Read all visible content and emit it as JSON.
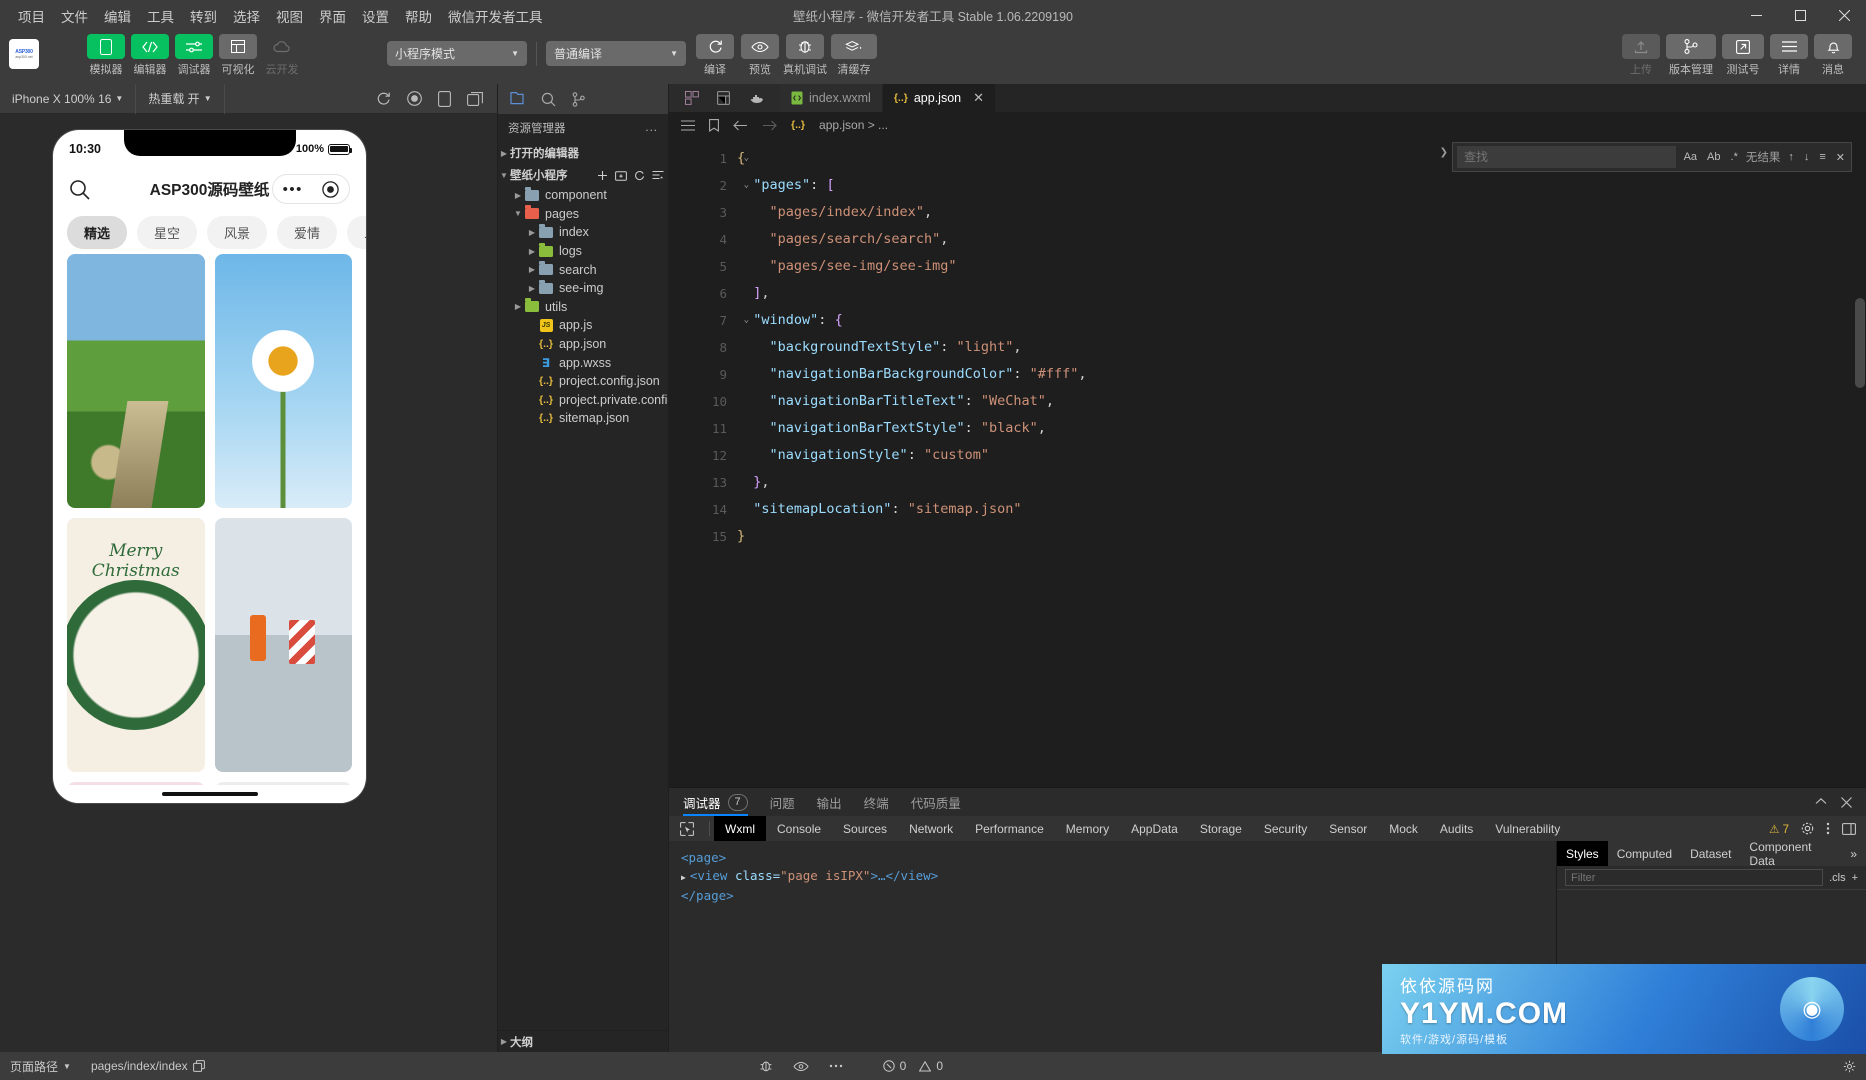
{
  "window": {
    "title": "壁纸小程序 - 微信开发者工具 Stable 1.06.2209190",
    "controls": {
      "minimize": "—",
      "maximize": "▢",
      "close": "✕"
    }
  },
  "menubar": [
    "项目",
    "文件",
    "编辑",
    "工具",
    "转到",
    "选择",
    "视图",
    "界面",
    "设置",
    "帮助",
    "微信开发者工具"
  ],
  "toolbar": {
    "logo": {
      "line1": "ASP300",
      "line2": "asp300.net"
    },
    "left_buttons": [
      {
        "label": "模拟器",
        "icon": "phone-icon",
        "style": "green"
      },
      {
        "label": "编辑器",
        "icon": "code-icon",
        "style": "green"
      },
      {
        "label": "调试器",
        "icon": "sliders-icon",
        "style": "green"
      },
      {
        "label": "可视化",
        "icon": "layout-icon",
        "style": "grey"
      },
      {
        "label": "云开发",
        "icon": "cloud-icon",
        "style": "dim"
      }
    ],
    "mode_select": "小程序模式",
    "compile_select": "普通编译",
    "action_buttons": [
      {
        "label": "编译",
        "icon": "refresh-icon"
      },
      {
        "label": "预览",
        "icon": "eye-icon"
      },
      {
        "label": "真机调试",
        "icon": "bug-icon"
      },
      {
        "label": "清缓存",
        "icon": "layers-icon"
      }
    ],
    "right_buttons": [
      {
        "label": "上传",
        "icon": "upload-icon",
        "disabled": true
      },
      {
        "label": "版本管理",
        "icon": "branch-icon",
        "disabled": false
      },
      {
        "label": "测试号",
        "icon": "external-link-icon",
        "disabled": false
      },
      {
        "label": "详情",
        "icon": "menu-icon",
        "disabled": false
      },
      {
        "label": "消息",
        "icon": "bell-icon",
        "disabled": false
      }
    ]
  },
  "simulator": {
    "device_select": "iPhone X 100% 16",
    "hotreload_select": "热重载 开",
    "icons": [
      "refresh-icon",
      "record-icon",
      "rotate-icon",
      "panel-icon"
    ],
    "phone": {
      "time": "10:30",
      "battery_text": "100%",
      "nav_title": "ASP300源码壁纸",
      "search_icon": "search-icon",
      "capsule": {
        "dots": "•••",
        "target": "◉"
      },
      "tabs": [
        "精选",
        "星空",
        "风景",
        "爱情",
        "二次"
      ],
      "active_tab": "精选",
      "cards": [
        {
          "name": "road-landscape",
          "art": "art-road"
        },
        {
          "name": "daisy-flower",
          "art": "art-daisy"
        },
        {
          "name": "merry-christmas-rabbit",
          "art": "art-xmas"
        },
        {
          "name": "miniature-workers",
          "art": "art-mini"
        },
        {
          "name": "pink-abstract",
          "art": "art-pk"
        },
        {
          "name": "white-abstract",
          "art": "art-wt"
        }
      ]
    }
  },
  "explorer": {
    "header": "资源管理器",
    "header_dots": "...",
    "top_icons": [
      "files-icon",
      "search-icon",
      "source-control-icon"
    ],
    "sections": [
      {
        "label": "打开的编辑器",
        "expanded": false
      },
      {
        "label": "壁纸小程序",
        "expanded": true
      }
    ],
    "section_actions": [
      "new-file-icon",
      "new-folder-icon",
      "refresh-icon",
      "collapse-icon"
    ],
    "tree": [
      {
        "label": "component",
        "type": "folder",
        "depth": 1,
        "open": false
      },
      {
        "label": "pages",
        "type": "folder-red",
        "depth": 1,
        "open": true
      },
      {
        "label": "index",
        "type": "folder",
        "depth": 2,
        "open": false
      },
      {
        "label": "logs",
        "type": "folder-green",
        "depth": 2,
        "open": false
      },
      {
        "label": "search",
        "type": "folder",
        "depth": 2,
        "open": false
      },
      {
        "label": "see-img",
        "type": "folder",
        "depth": 2,
        "open": false
      },
      {
        "label": "utils",
        "type": "folder-green",
        "depth": 1,
        "open": false
      },
      {
        "label": "app.js",
        "type": "js",
        "depth": 2
      },
      {
        "label": "app.json",
        "type": "json",
        "depth": 2
      },
      {
        "label": "app.wxss",
        "type": "wxss",
        "depth": 2
      },
      {
        "label": "project.config.json",
        "type": "json",
        "depth": 2
      },
      {
        "label": "project.private.config.js...",
        "type": "json",
        "depth": 2
      },
      {
        "label": "sitemap.json",
        "type": "json",
        "depth": 2
      }
    ],
    "outline": "大纲"
  },
  "editor": {
    "mini_icons": [
      "components-icon",
      "snippet-icon",
      "docker-icon"
    ],
    "tabs": [
      {
        "label": "index.wxml",
        "icon": "wxml-icon",
        "active": false,
        "closable": false
      },
      {
        "label": "app.json",
        "icon": "json-icon",
        "active": true,
        "closable": true
      }
    ],
    "breadcrumb_icons": [
      "list-icon",
      "bookmark-icon",
      "back-icon",
      "forward-icon"
    ],
    "breadcrumb": "app.json > ...",
    "find": {
      "placeholder": "查找",
      "value": "",
      "result": "无结果",
      "options": [
        "Aa",
        "Ab",
        ".*"
      ],
      "nav": [
        "↑",
        "↓",
        "≡",
        "✕"
      ]
    },
    "lines": [
      {
        "n": 1,
        "fold": "open",
        "tokens": [
          {
            "t": "{",
            "c": "k-y"
          }
        ]
      },
      {
        "n": 2,
        "fold": "open",
        "tokens": [
          {
            "t": "  ",
            "c": ""
          },
          {
            "t": "\"pages\"",
            "c": "k-prop"
          },
          {
            "t": ": ",
            "c": "k-pun"
          },
          {
            "t": "[",
            "c": "k-br"
          }
        ]
      },
      {
        "n": 3,
        "fold": "",
        "tokens": [
          {
            "t": "    ",
            "c": ""
          },
          {
            "t": "\"pages/index/index\"",
            "c": "k-str"
          },
          {
            "t": ",",
            "c": "k-pun"
          }
        ]
      },
      {
        "n": 4,
        "fold": "",
        "tokens": [
          {
            "t": "    ",
            "c": ""
          },
          {
            "t": "\"pages/search/search\"",
            "c": "k-str"
          },
          {
            "t": ",",
            "c": "k-pun"
          }
        ]
      },
      {
        "n": 5,
        "fold": "",
        "tokens": [
          {
            "t": "    ",
            "c": ""
          },
          {
            "t": "\"pages/see-img/see-img\"",
            "c": "k-str"
          }
        ]
      },
      {
        "n": 6,
        "fold": "",
        "tokens": [
          {
            "t": "  ",
            "c": ""
          },
          {
            "t": "]",
            "c": "k-br"
          },
          {
            "t": ",",
            "c": "k-pun"
          }
        ]
      },
      {
        "n": 7,
        "fold": "open",
        "tokens": [
          {
            "t": "  ",
            "c": ""
          },
          {
            "t": "\"window\"",
            "c": "k-prop"
          },
          {
            "t": ": ",
            "c": "k-pun"
          },
          {
            "t": "{",
            "c": "k-br"
          }
        ]
      },
      {
        "n": 8,
        "fold": "",
        "tokens": [
          {
            "t": "    ",
            "c": ""
          },
          {
            "t": "\"backgroundTextStyle\"",
            "c": "k-prop"
          },
          {
            "t": ": ",
            "c": "k-pun"
          },
          {
            "t": "\"light\"",
            "c": "k-str"
          },
          {
            "t": ",",
            "c": "k-pun"
          }
        ]
      },
      {
        "n": 9,
        "fold": "",
        "tokens": [
          {
            "t": "    ",
            "c": ""
          },
          {
            "t": "\"navigationBarBackgroundColor\"",
            "c": "k-prop"
          },
          {
            "t": ": ",
            "c": "k-pun"
          },
          {
            "t": "\"#fff\"",
            "c": "k-str"
          },
          {
            "t": ",",
            "c": "k-pun"
          }
        ]
      },
      {
        "n": 10,
        "fold": "",
        "tokens": [
          {
            "t": "    ",
            "c": ""
          },
          {
            "t": "\"navigationBarTitleText\"",
            "c": "k-prop"
          },
          {
            "t": ": ",
            "c": "k-pun"
          },
          {
            "t": "\"WeChat\"",
            "c": "k-str"
          },
          {
            "t": ",",
            "c": "k-pun"
          }
        ]
      },
      {
        "n": 11,
        "fold": "",
        "tokens": [
          {
            "t": "    ",
            "c": ""
          },
          {
            "t": "\"navigationBarTextStyle\"",
            "c": "k-prop"
          },
          {
            "t": ": ",
            "c": "k-pun"
          },
          {
            "t": "\"black\"",
            "c": "k-str"
          },
          {
            "t": ",",
            "c": "k-pun"
          }
        ]
      },
      {
        "n": 12,
        "fold": "",
        "tokens": [
          {
            "t": "    ",
            "c": ""
          },
          {
            "t": "\"navigationStyle\"",
            "c": "k-prop"
          },
          {
            "t": ": ",
            "c": "k-pun"
          },
          {
            "t": "\"custom\"",
            "c": "k-str"
          }
        ]
      },
      {
        "n": 13,
        "fold": "",
        "tokens": [
          {
            "t": "  ",
            "c": ""
          },
          {
            "t": "}",
            "c": "k-br"
          },
          {
            "t": ",",
            "c": "k-pun"
          }
        ]
      },
      {
        "n": 14,
        "fold": "",
        "tokens": [
          {
            "t": "  ",
            "c": ""
          },
          {
            "t": "\"sitemapLocation\"",
            "c": "k-prop"
          },
          {
            "t": ": ",
            "c": "k-pun"
          },
          {
            "t": "\"sitemap.json\"",
            "c": "k-str"
          }
        ]
      },
      {
        "n": 15,
        "fold": "",
        "tokens": [
          {
            "t": "}",
            "c": "k-y"
          }
        ]
      }
    ]
  },
  "debugger": {
    "panel_tabs": [
      {
        "label": "调试器",
        "badge": "7",
        "active": true
      },
      {
        "label": "问题",
        "badge": "",
        "active": false
      },
      {
        "label": "输出",
        "badge": "",
        "active": false
      },
      {
        "label": "终端",
        "badge": "",
        "active": false
      },
      {
        "label": "代码质量",
        "badge": "",
        "active": false
      }
    ],
    "panel_actions": [
      "collapse-icon",
      "close-icon"
    ],
    "devtools_tabs": [
      "Wxml",
      "Console",
      "Sources",
      "Network",
      "Performance",
      "Memory",
      "AppData",
      "Storage",
      "Security",
      "Sensor",
      "Mock",
      "Audits",
      "Vulnerability"
    ],
    "active_devtool": "Wxml",
    "inspect_icon": "cursor-select-icon",
    "warn_count": "7",
    "right_icons": [
      "gear-icon",
      "kebab-icon",
      "dock-icon"
    ],
    "wxml": [
      {
        "indent": 0,
        "arrow": false,
        "parts": [
          {
            "t": "<page>",
            "c": "wx-tag"
          }
        ]
      },
      {
        "indent": 0,
        "arrow": true,
        "parts": [
          {
            "t": "<view ",
            "c": "wx-tag"
          },
          {
            "t": "class=",
            "c": "wx-at"
          },
          {
            "t": "\"page isIPX\"",
            "c": "wx-val"
          },
          {
            "t": ">…</view>",
            "c": "wx-tag"
          }
        ]
      },
      {
        "indent": 0,
        "arrow": false,
        "parts": [
          {
            "t": "</page>",
            "c": "wx-tag"
          }
        ]
      }
    ],
    "styles_tabs": [
      "Styles",
      "Computed",
      "Dataset",
      "Component Data"
    ],
    "active_styles_tab": "Styles",
    "styles_more": "»",
    "filter_placeholder": "Filter",
    "cls_label": ".cls",
    "add_rule": "+"
  },
  "watermark": {
    "line1": "依依源码网",
    "line2": "Y1YM.COM",
    "line3": "软件/游戏/源码/模板"
  },
  "statusbar": {
    "path_label": "页面路径",
    "path_value": "pages/index/index",
    "copy_icon": "copy-icon",
    "error_count": "0",
    "warning_count": "0",
    "right_icons": [
      "debug-icon",
      "eye-icon",
      "more-icon",
      "settings-icon"
    ]
  }
}
